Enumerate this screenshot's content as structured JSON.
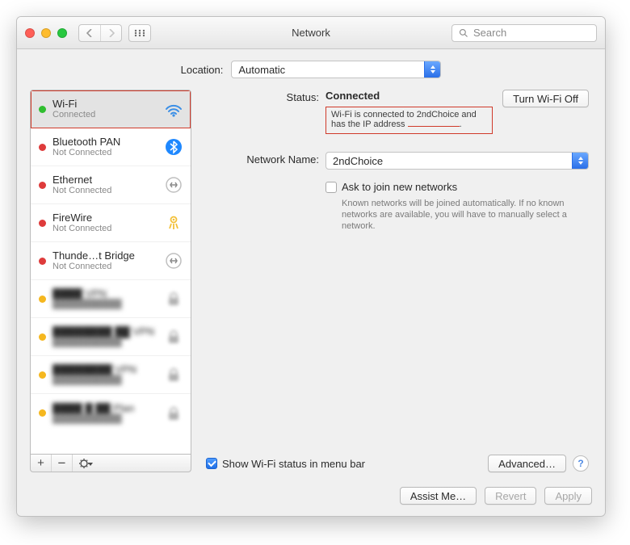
{
  "window": {
    "title": "Network"
  },
  "toolbar": {
    "search_placeholder": "Search"
  },
  "location": {
    "label": "Location:",
    "value": "Automatic"
  },
  "sidebar": {
    "items": [
      {
        "name": "Wi-Fi",
        "sub": "Connected",
        "status": "green",
        "icon": "wifi"
      },
      {
        "name": "Bluetooth PAN",
        "sub": "Not Connected",
        "status": "red",
        "icon": "bluetooth"
      },
      {
        "name": "Ethernet",
        "sub": "Not Connected",
        "status": "red",
        "icon": "ethernet"
      },
      {
        "name": "FireWire",
        "sub": "Not Connected",
        "status": "red",
        "icon": "firewire"
      },
      {
        "name": "Thunde…t Bridge",
        "sub": "Not Connected",
        "status": "red",
        "icon": "ethernet"
      },
      {
        "name": "████ VPN",
        "sub": "███████████",
        "status": "amber",
        "icon": "lock"
      },
      {
        "name": "████████ ██ VPN",
        "sub": "███████████",
        "status": "amber",
        "icon": "lock"
      },
      {
        "name": "████████ VPN",
        "sub": "███████████",
        "status": "amber",
        "icon": "lock"
      },
      {
        "name": "████ █ ██ Plan",
        "sub": "███████████",
        "status": "amber",
        "icon": "lock"
      }
    ]
  },
  "detail": {
    "status_label": "Status:",
    "status_value": "Connected",
    "wifi_off_label": "Turn Wi-Fi Off",
    "status_text_prefix": "Wi-Fi is connected to 2ndChoice and has the IP address ",
    "network_name_label": "Network Name:",
    "network_name_value": "2ndChoice",
    "ask_join_label": "Ask to join new networks",
    "ask_join_fine": "Known networks will be joined automatically. If no known networks are available, you will have to manually select a network.",
    "show_status_label": "Show Wi-Fi status in menu bar",
    "advanced_label": "Advanced…"
  },
  "footer": {
    "assist": "Assist Me…",
    "revert": "Revert",
    "apply": "Apply"
  }
}
